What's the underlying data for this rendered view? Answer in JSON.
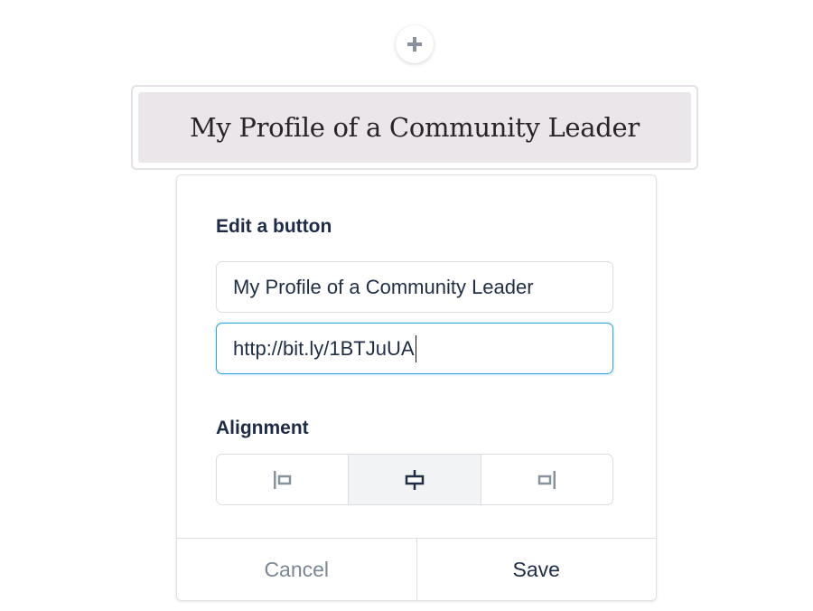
{
  "add_block": {
    "icon": "plus-icon"
  },
  "preview": {
    "button_text": "My Profile of a Community Leader"
  },
  "editor": {
    "heading": "Edit a button",
    "label_field": {
      "value": "My Profile of a Community Leader"
    },
    "link_field": {
      "value": "http://bit.ly/1BTJuUA",
      "focused": true
    },
    "alignment": {
      "heading": "Alignment",
      "options": [
        {
          "name": "left",
          "icon": "align-left-icon",
          "selected": false
        },
        {
          "name": "center",
          "icon": "align-center-icon",
          "selected": true
        },
        {
          "name": "right",
          "icon": "align-right-icon",
          "selected": false
        }
      ]
    },
    "cancel_label": "Cancel",
    "save_label": "Save"
  },
  "colors": {
    "focus": "#31a5e0",
    "heading": "#1d2b45",
    "preview_bg": "#eae6ea",
    "muted": "#7b8794"
  }
}
